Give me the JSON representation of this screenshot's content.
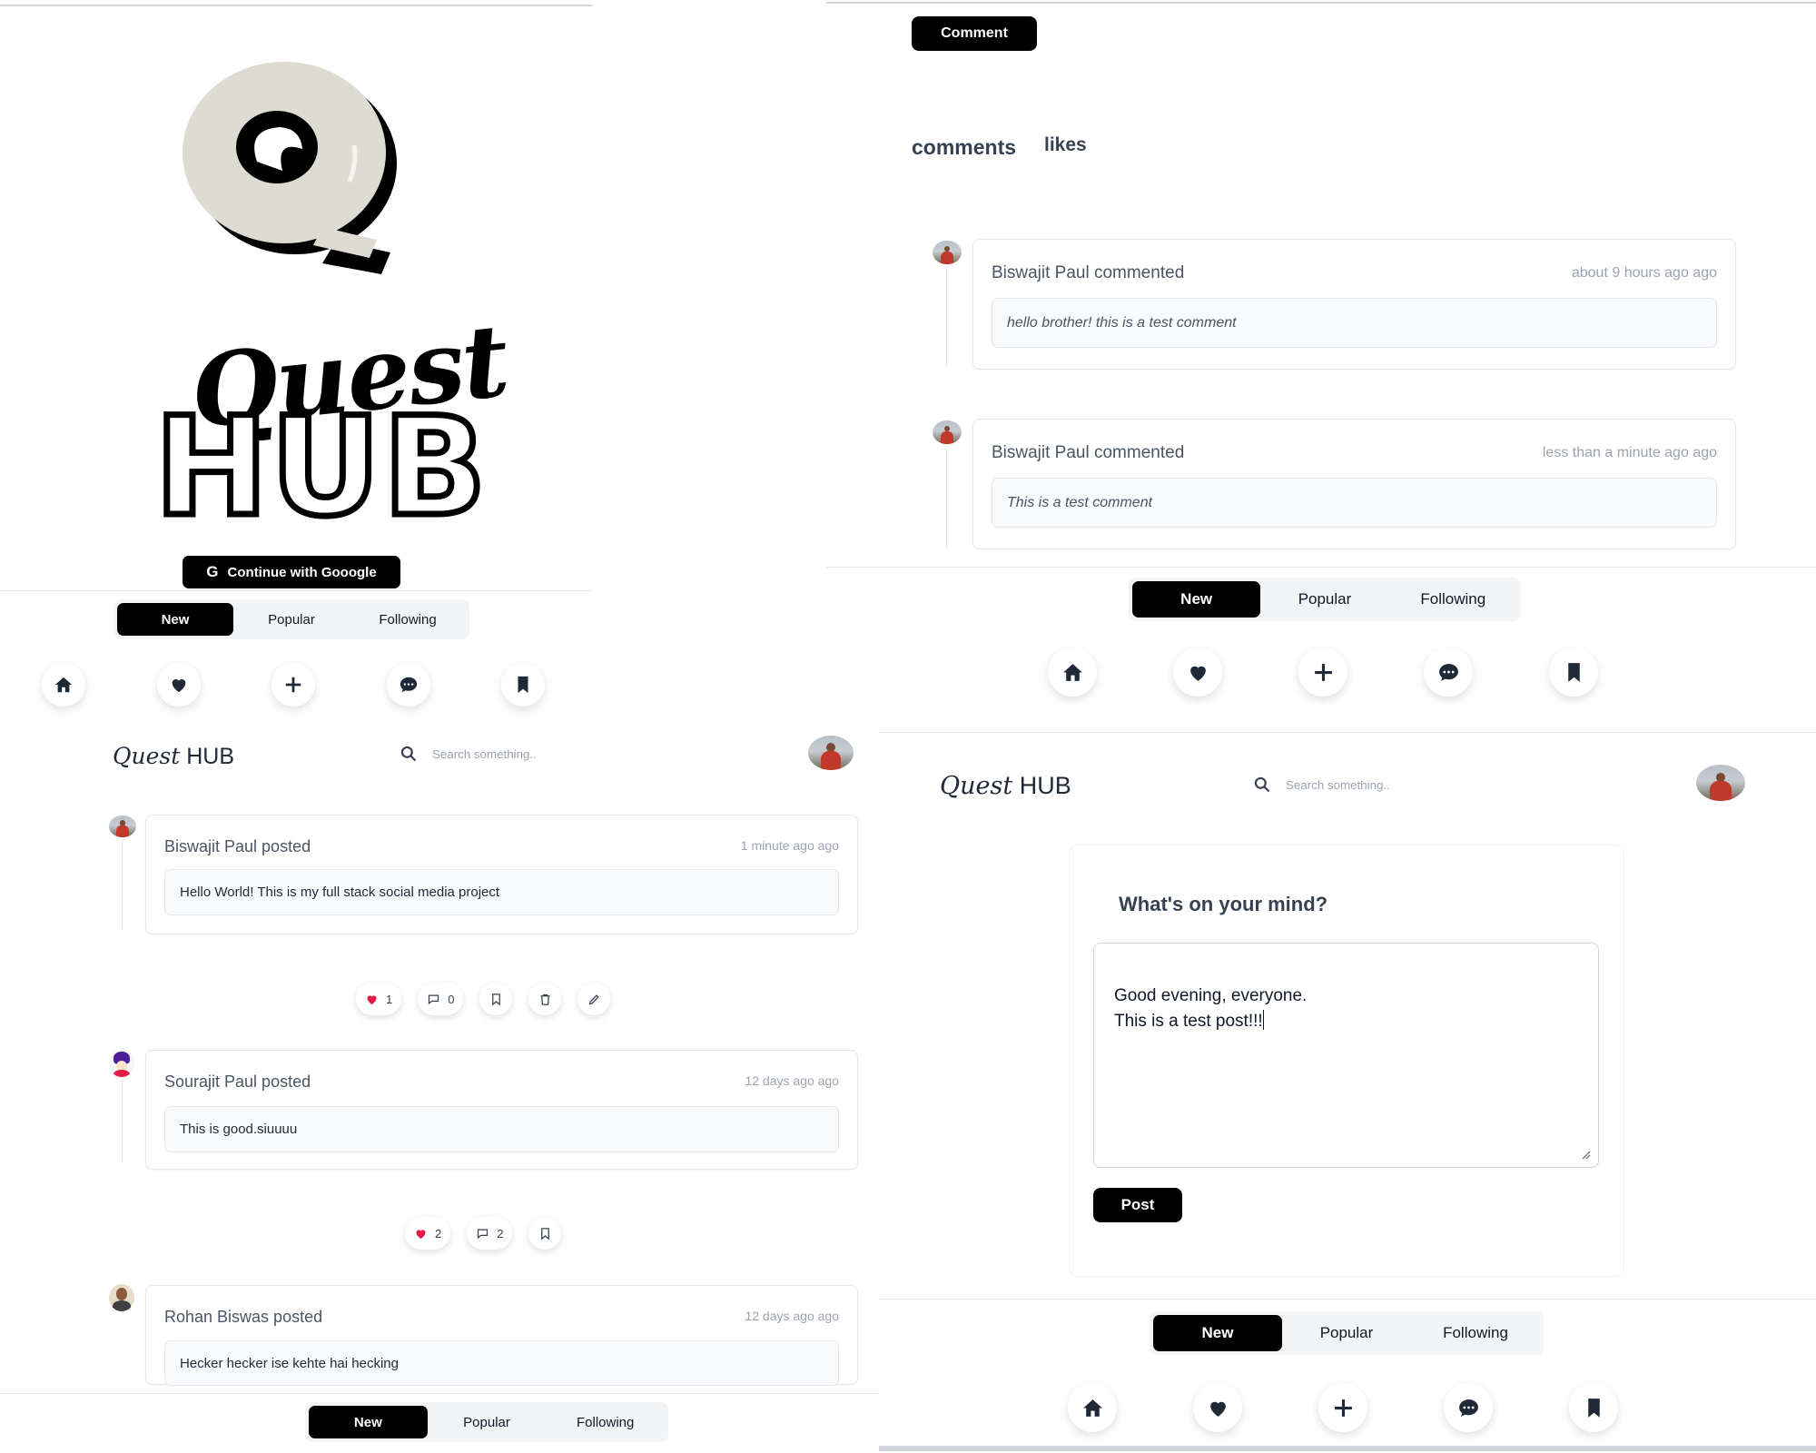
{
  "logo": {
    "quest": "Quest",
    "hub": "HUB"
  },
  "login": {
    "google_label": "Continue with Gooogle"
  },
  "tabs": [
    "New",
    "Popular",
    "Following"
  ],
  "brand": {
    "quest": "Quest",
    "hub": " HUB"
  },
  "search": {
    "placeholder": "Search something.."
  },
  "feed": {
    "posts": [
      {
        "author": "Biswajit Paul posted",
        "time": "1 minute ago ago",
        "text": "Hello World! This is my full stack social media project",
        "likes": "1",
        "comments": "0"
      },
      {
        "author": "Sourajit Paul posted",
        "time": "12 days ago ago",
        "text": "This is good.siuuuu",
        "likes": "2",
        "comments": "2"
      },
      {
        "author": "Rohan Biswas posted",
        "time": "12 days ago ago",
        "text": "Hecker hecker ise kehte hai hecking"
      }
    ]
  },
  "comments_view": {
    "comment_button": "Comment",
    "tab_comments": "comments",
    "tab_likes": "likes",
    "items": [
      {
        "author": "Biswajit Paul commented",
        "time": "about 9 hours ago ago",
        "text": "hello brother! this is a test comment"
      },
      {
        "author": "Biswajit Paul commented",
        "time": "less than a minute ago ago",
        "text": "This is a test comment"
      }
    ]
  },
  "create": {
    "title": "What's on your mind?",
    "text": "Good evening, everyone.\nThis is a test post!!!",
    "post_button": "Post"
  },
  "icons": [
    "home-icon",
    "heart-icon",
    "plus-icon",
    "chat-icon",
    "bookmark-icon",
    "search-icon",
    "comment-icon",
    "trash-icon",
    "pencil-icon",
    "google-icon"
  ],
  "colors": {
    "accent": "#000000",
    "like": "#e11d48",
    "logo_q": "#dedbd2"
  }
}
